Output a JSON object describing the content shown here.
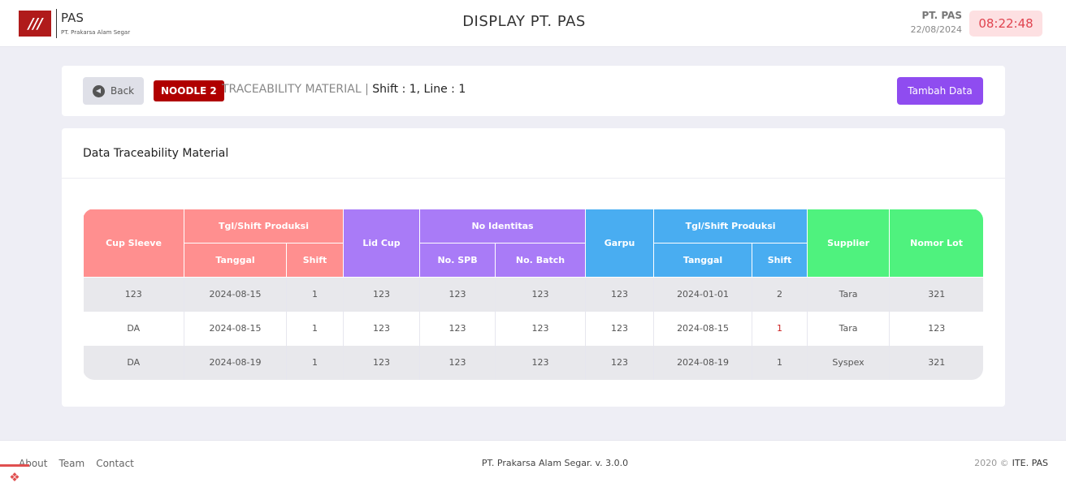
{
  "header": {
    "logo_mark": "///",
    "logo_title": "PAS",
    "logo_subtitle": "PT. Prakarsa Alam Segar",
    "app_title": "DISPLAY PT. PAS",
    "company": "PT. PAS",
    "date": "22/08/2024",
    "clock": "08:22:48"
  },
  "toolbar": {
    "back_label": "Back",
    "badge": "NOODLE 2",
    "title": "TRACEABILITY MATERIAL",
    "separator": "|",
    "shift_info": "Shift : 1, Line : 1",
    "add_label": "Tambah Data"
  },
  "card": {
    "title": "Data Traceability Material"
  },
  "table": {
    "headers": {
      "cup_sleeve": "Cup Sleeve",
      "tgl_shift_1": "Tgl/Shift Produksi",
      "lid_cup": "Lid Cup",
      "no_identitas": "No Identitas",
      "garpu": "Garpu",
      "tgl_shift_2": "Tgl/Shift Produksi",
      "supplier": "Supplier",
      "nomor_lot": "Nomor Lot",
      "tanggal_1": "Tanggal",
      "shift_1": "Shift",
      "no_spb": "No. SPB",
      "no_batch": "No. Batch",
      "tanggal_2": "Tanggal",
      "shift_2": "Shift"
    },
    "rows": [
      [
        "123",
        "2024-08-15",
        "1",
        "123",
        "123",
        "123",
        "123",
        "2024-01-01",
        "2",
        "Tara",
        "321"
      ],
      [
        "DA",
        "2024-08-15",
        "1",
        "123",
        "123",
        "123",
        "123",
        "2024-08-15",
        "1",
        "Tara",
        "123"
      ],
      [
        "DA",
        "2024-08-19",
        "1",
        "123",
        "123",
        "123",
        "123",
        "2024-08-19",
        "1",
        "Syspex",
        "321"
      ]
    ]
  },
  "colors": {
    "red_header": "#ff8f8f",
    "purple_header": "#a97bf7",
    "blue_header": "#49adf1",
    "green_header": "#4ff27e",
    "primary_button": "#8f4cf0",
    "badge": "#b00000"
  },
  "footer": {
    "links": [
      "About",
      "Team",
      "Contact"
    ],
    "center": "PT. Prakarsa Alam Segar. v. 3.0.0",
    "year": "2020 ©",
    "brand": "ITE. PAS",
    "corner_icon": "laravel-icon"
  }
}
